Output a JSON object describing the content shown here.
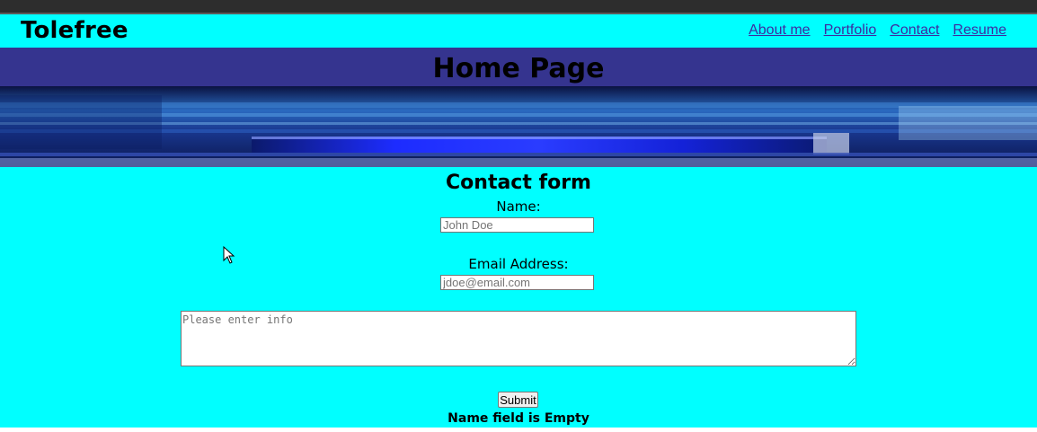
{
  "header": {
    "brand": "Tolefree",
    "nav": [
      "About me",
      "Portfolio",
      "Contact",
      "Resume"
    ]
  },
  "hero": {
    "title": "Home Page"
  },
  "form": {
    "title": "Contact form",
    "name_label": "Name:",
    "name_placeholder": "John Doe",
    "email_label": "Email Address:",
    "email_placeholder": "jdoe@email.com",
    "message_placeholder": "Please enter info",
    "submit_label": "Submit",
    "error_text": "Name field is Empty"
  },
  "colors": {
    "page_background": "#00ffff",
    "title_bar": "#35348f",
    "link": "#3d2ba0"
  }
}
